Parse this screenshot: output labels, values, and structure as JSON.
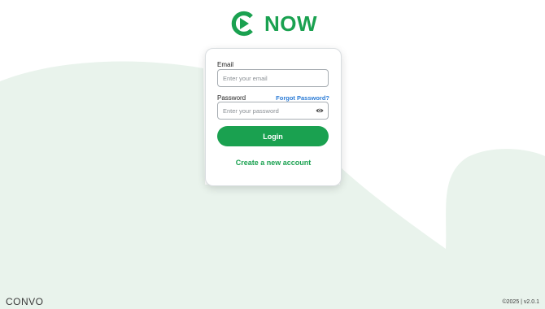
{
  "brand": {
    "logo_text": "NOW",
    "logo_icon": "c-arrow-icon",
    "footer_brand": "CONVO",
    "accent": "#1aa150",
    "link_color": "#2a7bd6",
    "bg_blob": "#e9f3ec"
  },
  "login_form": {
    "email_label": "Email",
    "email_placeholder": "Enter your email",
    "password_label": "Password",
    "forgot_label": "Forgot Password?",
    "password_placeholder": "Enter your password",
    "password_toggle_icon": "eye-icon",
    "login_button": "Login",
    "create_account": "Create a new account"
  },
  "footer": {
    "version_text": "©2025 | v2.0.1"
  }
}
